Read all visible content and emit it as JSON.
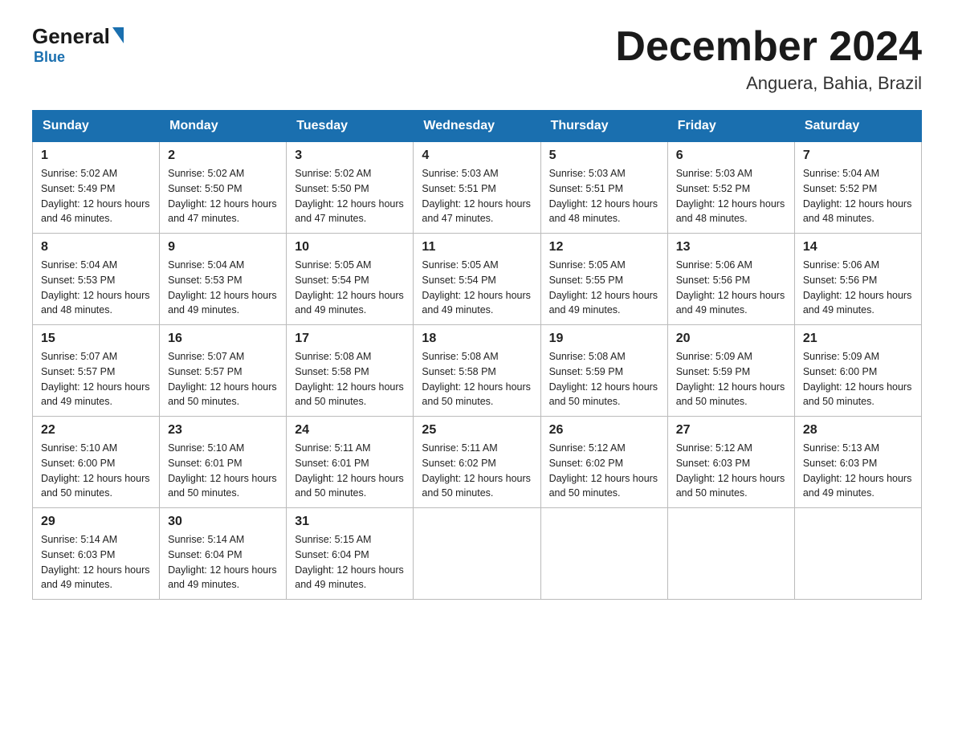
{
  "logo": {
    "general": "General",
    "blue": "Blue"
  },
  "title": "December 2024",
  "subtitle": "Anguera, Bahia, Brazil",
  "days_of_week": [
    "Sunday",
    "Monday",
    "Tuesday",
    "Wednesday",
    "Thursday",
    "Friday",
    "Saturday"
  ],
  "weeks": [
    [
      {
        "day": "1",
        "sunrise": "5:02 AM",
        "sunset": "5:49 PM",
        "daylight": "12 hours and 46 minutes."
      },
      {
        "day": "2",
        "sunrise": "5:02 AM",
        "sunset": "5:50 PM",
        "daylight": "12 hours and 47 minutes."
      },
      {
        "day": "3",
        "sunrise": "5:02 AM",
        "sunset": "5:50 PM",
        "daylight": "12 hours and 47 minutes."
      },
      {
        "day": "4",
        "sunrise": "5:03 AM",
        "sunset": "5:51 PM",
        "daylight": "12 hours and 47 minutes."
      },
      {
        "day": "5",
        "sunrise": "5:03 AM",
        "sunset": "5:51 PM",
        "daylight": "12 hours and 48 minutes."
      },
      {
        "day": "6",
        "sunrise": "5:03 AM",
        "sunset": "5:52 PM",
        "daylight": "12 hours and 48 minutes."
      },
      {
        "day": "7",
        "sunrise": "5:04 AM",
        "sunset": "5:52 PM",
        "daylight": "12 hours and 48 minutes."
      }
    ],
    [
      {
        "day": "8",
        "sunrise": "5:04 AM",
        "sunset": "5:53 PM",
        "daylight": "12 hours and 48 minutes."
      },
      {
        "day": "9",
        "sunrise": "5:04 AM",
        "sunset": "5:53 PM",
        "daylight": "12 hours and 49 minutes."
      },
      {
        "day": "10",
        "sunrise": "5:05 AM",
        "sunset": "5:54 PM",
        "daylight": "12 hours and 49 minutes."
      },
      {
        "day": "11",
        "sunrise": "5:05 AM",
        "sunset": "5:54 PM",
        "daylight": "12 hours and 49 minutes."
      },
      {
        "day": "12",
        "sunrise": "5:05 AM",
        "sunset": "5:55 PM",
        "daylight": "12 hours and 49 minutes."
      },
      {
        "day": "13",
        "sunrise": "5:06 AM",
        "sunset": "5:56 PM",
        "daylight": "12 hours and 49 minutes."
      },
      {
        "day": "14",
        "sunrise": "5:06 AM",
        "sunset": "5:56 PM",
        "daylight": "12 hours and 49 minutes."
      }
    ],
    [
      {
        "day": "15",
        "sunrise": "5:07 AM",
        "sunset": "5:57 PM",
        "daylight": "12 hours and 49 minutes."
      },
      {
        "day": "16",
        "sunrise": "5:07 AM",
        "sunset": "5:57 PM",
        "daylight": "12 hours and 50 minutes."
      },
      {
        "day": "17",
        "sunrise": "5:08 AM",
        "sunset": "5:58 PM",
        "daylight": "12 hours and 50 minutes."
      },
      {
        "day": "18",
        "sunrise": "5:08 AM",
        "sunset": "5:58 PM",
        "daylight": "12 hours and 50 minutes."
      },
      {
        "day": "19",
        "sunrise": "5:08 AM",
        "sunset": "5:59 PM",
        "daylight": "12 hours and 50 minutes."
      },
      {
        "day": "20",
        "sunrise": "5:09 AM",
        "sunset": "5:59 PM",
        "daylight": "12 hours and 50 minutes."
      },
      {
        "day": "21",
        "sunrise": "5:09 AM",
        "sunset": "6:00 PM",
        "daylight": "12 hours and 50 minutes."
      }
    ],
    [
      {
        "day": "22",
        "sunrise": "5:10 AM",
        "sunset": "6:00 PM",
        "daylight": "12 hours and 50 minutes."
      },
      {
        "day": "23",
        "sunrise": "5:10 AM",
        "sunset": "6:01 PM",
        "daylight": "12 hours and 50 minutes."
      },
      {
        "day": "24",
        "sunrise": "5:11 AM",
        "sunset": "6:01 PM",
        "daylight": "12 hours and 50 minutes."
      },
      {
        "day": "25",
        "sunrise": "5:11 AM",
        "sunset": "6:02 PM",
        "daylight": "12 hours and 50 minutes."
      },
      {
        "day": "26",
        "sunrise": "5:12 AM",
        "sunset": "6:02 PM",
        "daylight": "12 hours and 50 minutes."
      },
      {
        "day": "27",
        "sunrise": "5:12 AM",
        "sunset": "6:03 PM",
        "daylight": "12 hours and 50 minutes."
      },
      {
        "day": "28",
        "sunrise": "5:13 AM",
        "sunset": "6:03 PM",
        "daylight": "12 hours and 49 minutes."
      }
    ],
    [
      {
        "day": "29",
        "sunrise": "5:14 AM",
        "sunset": "6:03 PM",
        "daylight": "12 hours and 49 minutes."
      },
      {
        "day": "30",
        "sunrise": "5:14 AM",
        "sunset": "6:04 PM",
        "daylight": "12 hours and 49 minutes."
      },
      {
        "day": "31",
        "sunrise": "5:15 AM",
        "sunset": "6:04 PM",
        "daylight": "12 hours and 49 minutes."
      },
      null,
      null,
      null,
      null
    ]
  ]
}
